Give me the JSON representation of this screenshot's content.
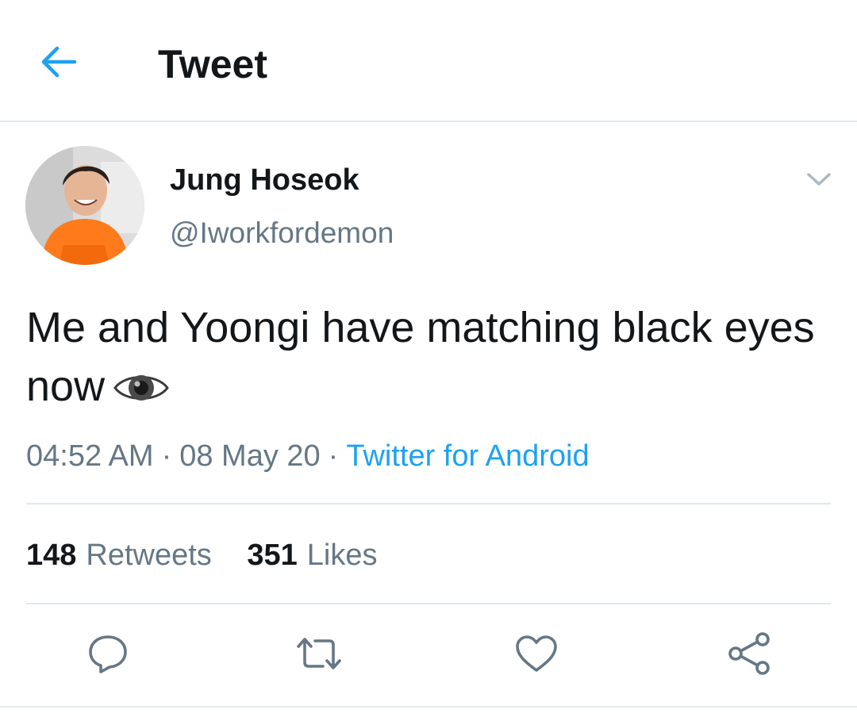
{
  "header": {
    "title": "Tweet",
    "back_icon": "arrow-left-icon"
  },
  "tweet": {
    "author": {
      "display_name": "Jung Hoseok",
      "handle": "@Iworkfordemon",
      "avatar": "avatar-photo"
    },
    "text": "Me and Yoongi have matching black eyes now",
    "emoji": "eye-emoji",
    "time": "04:52 AM",
    "date": "08 May 20",
    "separator": "·",
    "source": "Twitter for Android",
    "stats": {
      "retweets_count": "148",
      "retweets_label": "Retweets",
      "likes_count": "351",
      "likes_label": "Likes"
    }
  },
  "actions": [
    {
      "name": "reply",
      "icon": "reply-icon"
    },
    {
      "name": "retweet",
      "icon": "retweet-icon"
    },
    {
      "name": "like",
      "icon": "heart-icon"
    },
    {
      "name": "share",
      "icon": "share-icon"
    }
  ],
  "colors": {
    "accent": "#1da1f2",
    "text_primary": "#14171a",
    "text_secondary": "#657786",
    "divider": "#e1e8ed"
  }
}
